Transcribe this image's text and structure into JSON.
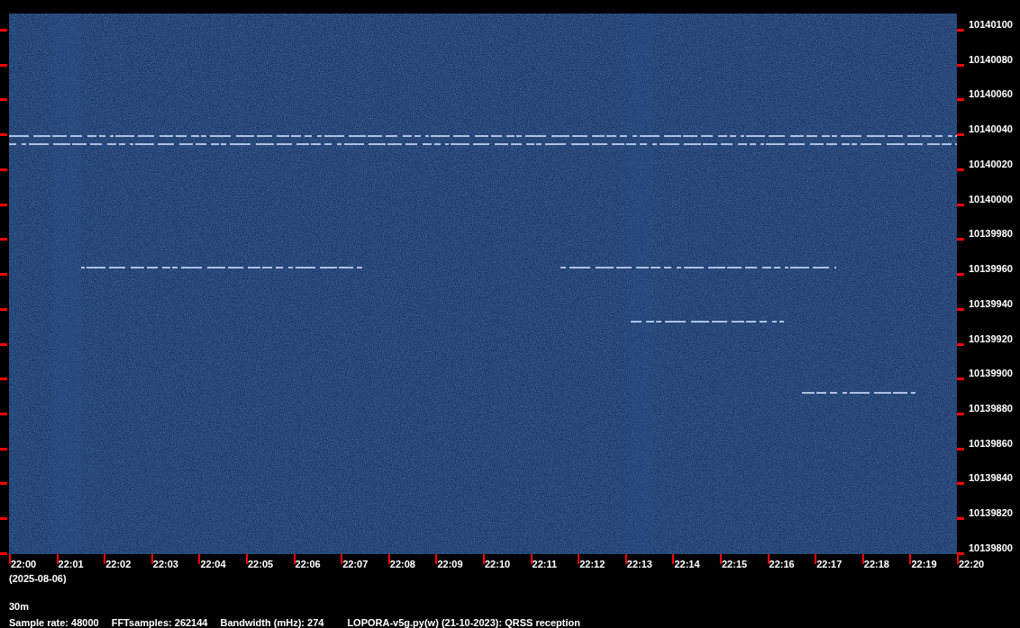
{
  "frequency_axis": [
    "10140100",
    "10140080",
    "10140060",
    "10140040",
    "10140020",
    "10140000",
    "10139980",
    "10139960",
    "10139940",
    "10139920",
    "10139900",
    "10139880",
    "10139860",
    "10139840",
    "10139820",
    "10139800"
  ],
  "time_axis": [
    "22:00",
    "22:01",
    "22:02",
    "22:03",
    "22:04",
    "22:05",
    "22:06",
    "22:07",
    "22:08",
    "22:09",
    "22:10",
    "22:11",
    "22:12",
    "22:13",
    "22:14",
    "22:15",
    "22:16",
    "22:17",
    "22:18",
    "22:19",
    "22:20"
  ],
  "date": "(2025-08-06)",
  "band": "30m",
  "footer": [
    "Sample rate: 48000",
    "FFTsamples: 262144",
    "Bandwidth (mHz): 274",
    "LOPORA-v5g.py(w) (21-10-2023): QRSS reception"
  ]
}
